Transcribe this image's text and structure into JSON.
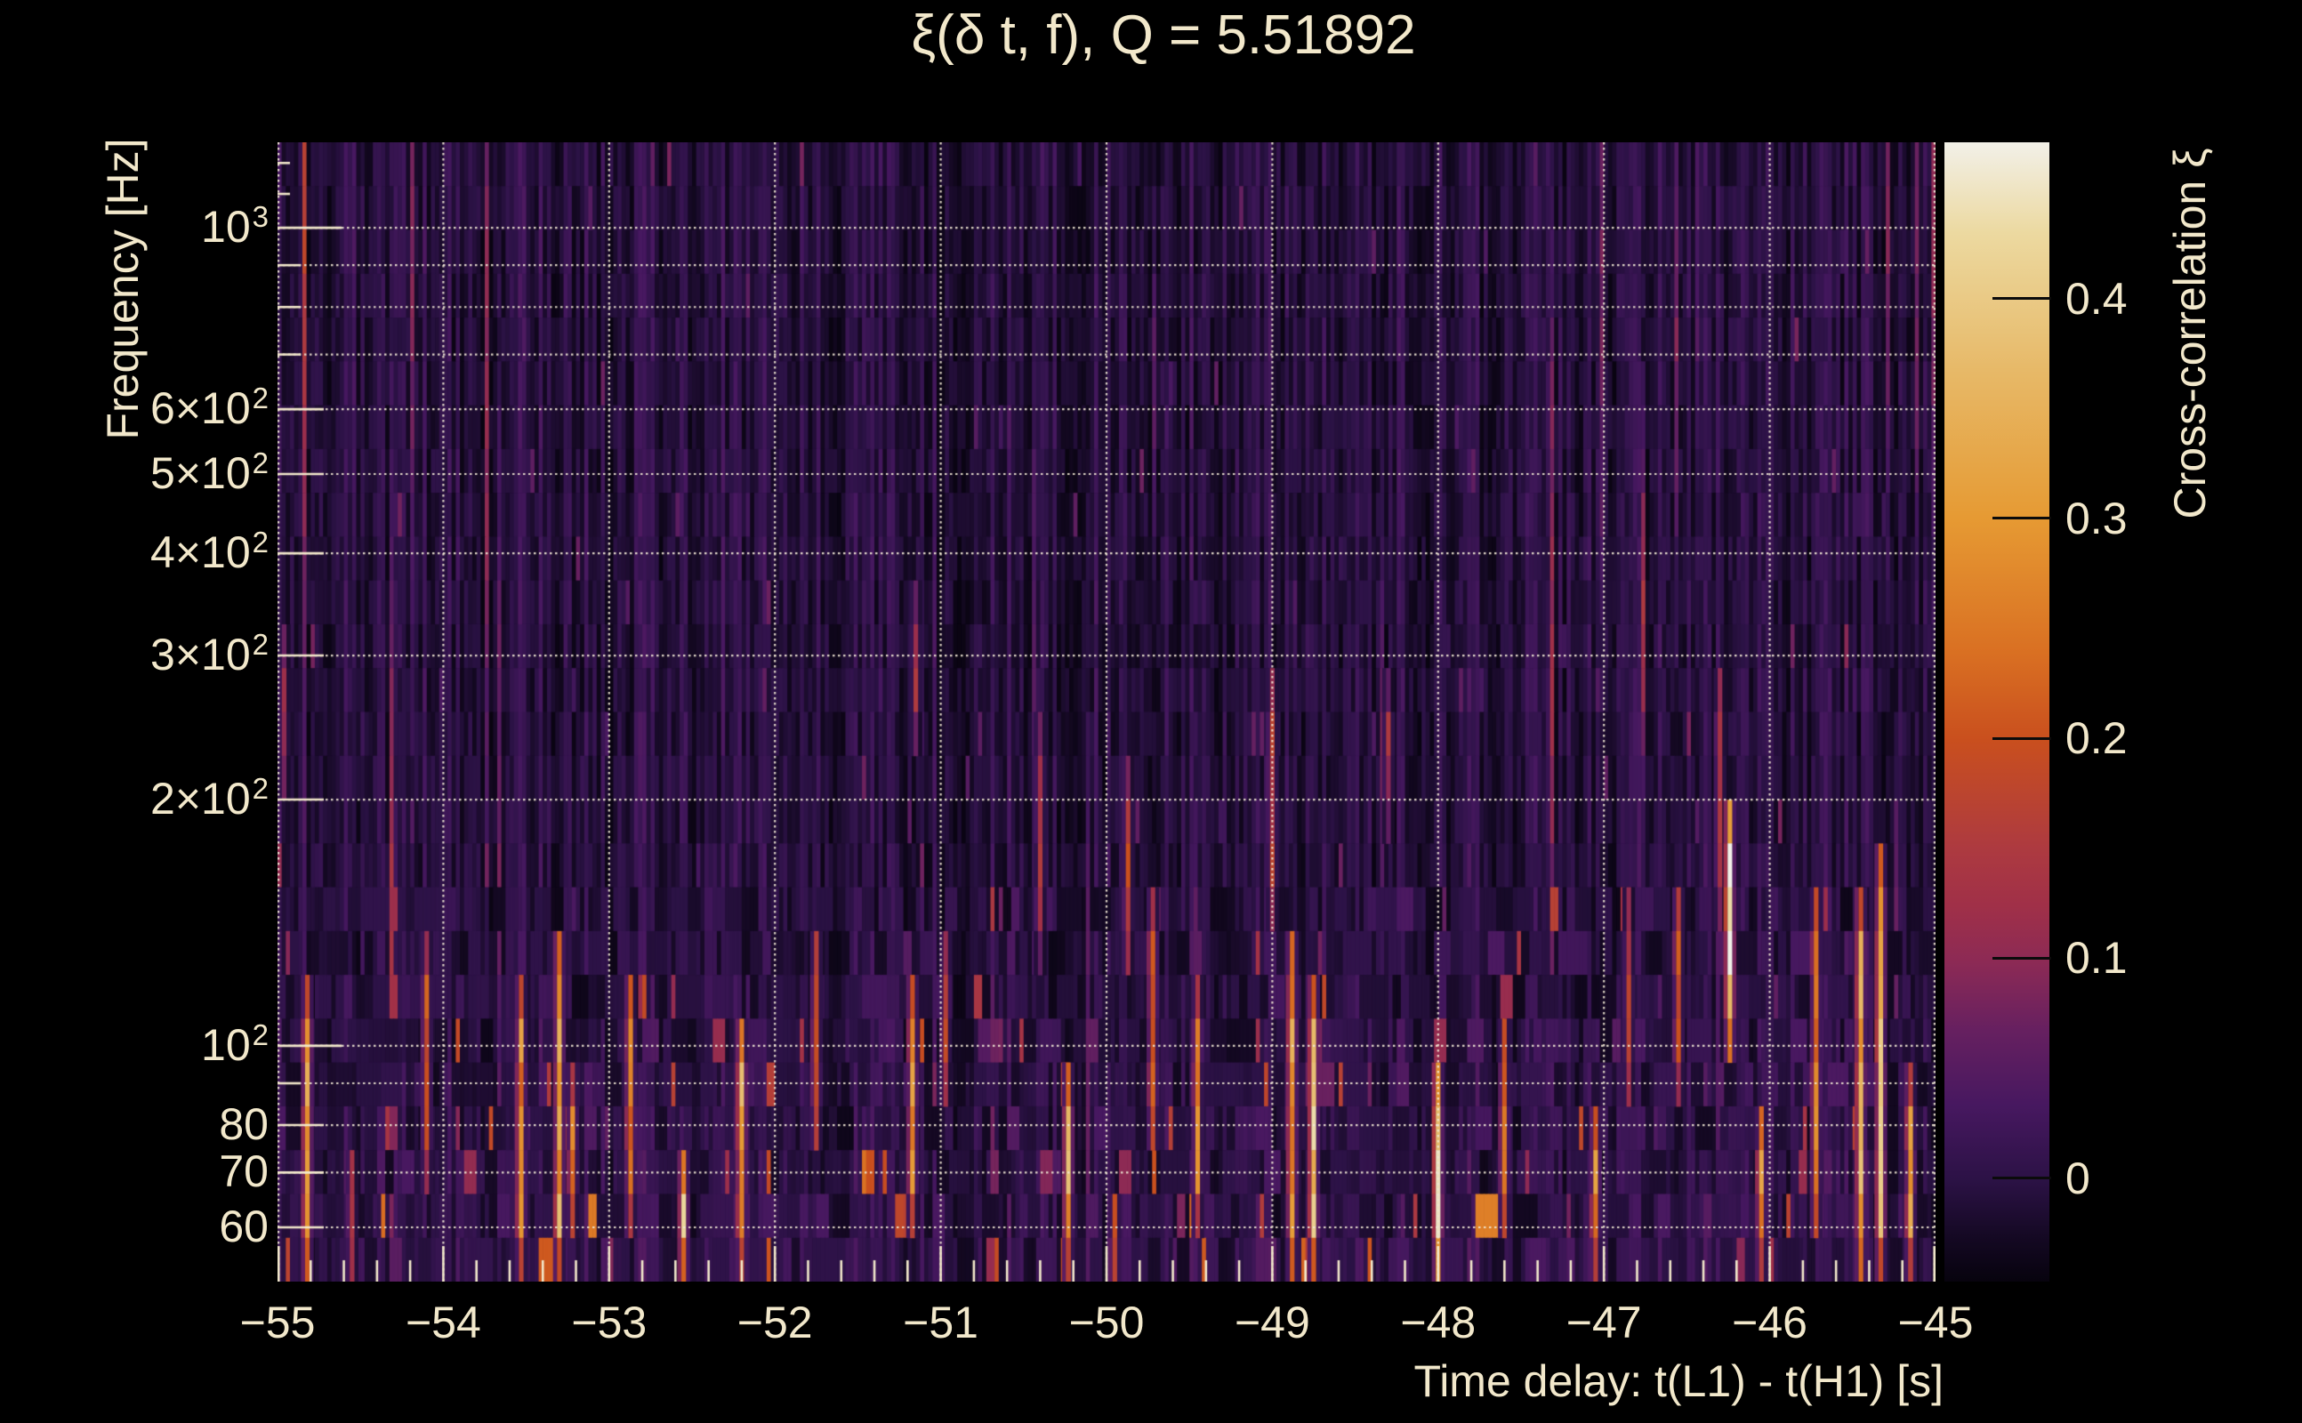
{
  "title": {
    "text": "ξ(δ t, f), Q = 5.51892"
  },
  "axes": {
    "x": {
      "title": "Time delay: t(L1) - t(H1) [s]",
      "range_s": [
        -55,
        -45
      ],
      "major_ticks": [
        {
          "value": -55,
          "label": "−55"
        },
        {
          "value": -54,
          "label": "−54"
        },
        {
          "value": -53,
          "label": "−53"
        },
        {
          "value": -52,
          "label": "−52"
        },
        {
          "value": -51,
          "label": "−51"
        },
        {
          "value": -50,
          "label": "−50"
        },
        {
          "value": -49,
          "label": "−49"
        },
        {
          "value": -48,
          "label": "−48"
        },
        {
          "value": -47,
          "label": "−47"
        },
        {
          "value": -46,
          "label": "−46"
        },
        {
          "value": -45,
          "label": "−45"
        }
      ],
      "minor_tick_step": 0.2
    },
    "y": {
      "title": "Frequency [Hz]",
      "scale": "log",
      "range_hz": [
        51.5,
        1272
      ],
      "tick_labels": [
        {
          "f": 1000,
          "base": "10",
          "sup": "3"
        },
        {
          "f": 600,
          "base": "6×10",
          "sup": "2"
        },
        {
          "f": 500,
          "base": "5×10",
          "sup": "2"
        },
        {
          "f": 400,
          "base": "4×10",
          "sup": "2"
        },
        {
          "f": 300,
          "base": "3×10",
          "sup": "2"
        },
        {
          "f": 200,
          "base": "2×10",
          "sup": "2"
        },
        {
          "f": 100,
          "base": "10",
          "sup": "2"
        },
        {
          "f": 80,
          "base": "80",
          "sup": ""
        },
        {
          "f": 70,
          "base": "70",
          "sup": ""
        },
        {
          "f": 60,
          "base": "60",
          "sup": ""
        }
      ],
      "gridline_freqs": [
        60,
        70,
        80,
        90,
        100,
        200,
        300,
        400,
        500,
        600,
        700,
        800,
        900,
        1000
      ],
      "decade_tick_freqs": [
        100,
        1000
      ],
      "unlabeled_tick_freqs": [
        90,
        700,
        800,
        900
      ],
      "tiny_tick_freqs": [
        1100,
        1200
      ]
    }
  },
  "colorbar": {
    "title": "Cross-correlation ξ",
    "range": [
      -0.047,
      0.471
    ],
    "ticks": [
      {
        "value": 0,
        "label": "0"
      },
      {
        "value": 0.1,
        "label": "0.1"
      },
      {
        "value": 0.2,
        "label": "0.2"
      },
      {
        "value": 0.3,
        "label": "0.3"
      },
      {
        "value": 0.4,
        "label": "0.4"
      }
    ]
  },
  "colors": {
    "background": "#000000",
    "text": "#f2e8cb",
    "grid": "#efe6d2",
    "tick": "#f2e8cb",
    "colorbar_tick_line": "#0b0b0b"
  },
  "chart_data": {
    "type": "heatmap",
    "title": "ξ(δ t, f), Q = 5.51892",
    "xlabel": "Time delay: t(L1) - t(H1) [s]",
    "ylabel": "Frequency [Hz]",
    "x_range_s": [
      -55,
      -45
    ],
    "y_range_hz": [
      51.5,
      1272
    ],
    "y_scale": "log",
    "z_range": [
      -0.047,
      0.471
    ],
    "grid": true,
    "legend_position": "right-colorbar",
    "palette": [
      {
        "u": 0.0,
        "color": "#07030e"
      },
      {
        "u": 0.04,
        "color": "#150924"
      },
      {
        "u": 0.09,
        "color": "#2c1246"
      },
      {
        "u": 0.155,
        "color": "#471860"
      },
      {
        "u": 0.22,
        "color": "#662060"
      },
      {
        "u": 0.28,
        "color": "#8c2a55"
      },
      {
        "u": 0.33,
        "color": "#a03048"
      },
      {
        "u": 0.38,
        "color": "#ad3a40"
      },
      {
        "u": 0.475,
        "color": "#c94f1e"
      },
      {
        "u": 0.55,
        "color": "#d96f22"
      },
      {
        "u": 0.67,
        "color": "#e69a33"
      },
      {
        "u": 0.8,
        "color": "#e7b968"
      },
      {
        "u": 0.92,
        "color": "#ecd9a0"
      },
      {
        "u": 1.0,
        "color": "#f2f0e8"
      }
    ],
    "background_noise": {
      "seed": 20250901,
      "cols": 400,
      "rows": 26,
      "base_xi": 0.0,
      "jitter_xi": 0.034,
      "low_freq_boost_start_rowfrac": 0.58,
      "note": "stochastic dark-purple vertical striations, amplitude increasing toward low frequency"
    },
    "hot_streaks": [
      {
        "t": -54.96,
        "f_lo": 210,
        "f_hi": 300,
        "xi": 0.13
      },
      {
        "t": -54.82,
        "f_lo": 52,
        "f_hi": 115,
        "xi": 0.31
      },
      {
        "t": -54.55,
        "f_lo": 52,
        "f_hi": 72,
        "xi": 0.18
      },
      {
        "t": -54.1,
        "f_lo": 70,
        "f_hi": 125,
        "xi": 0.22
      },
      {
        "t": -53.53,
        "f_lo": 58,
        "f_hi": 110,
        "xi": 0.28
      },
      {
        "t": -53.3,
        "f_lo": 52,
        "f_hi": 135,
        "xi": 0.33
      },
      {
        "t": -53.22,
        "f_lo": 60,
        "f_hi": 95,
        "xi": 0.25
      },
      {
        "t": -52.87,
        "f_lo": 65,
        "f_hi": 120,
        "xi": 0.27
      },
      {
        "t": -52.55,
        "f_lo": 52,
        "f_hi": 68,
        "xi": 0.38
      },
      {
        "t": -52.2,
        "f_lo": 52,
        "f_hi": 100,
        "xi": 0.33
      },
      {
        "t": -51.75,
        "f_lo": 80,
        "f_hi": 130,
        "xi": 0.22
      },
      {
        "t": -51.17,
        "f_lo": 60,
        "f_hi": 115,
        "xi": 0.28
      },
      {
        "t": -51.15,
        "f_lo": 240,
        "f_hi": 360,
        "xi": 0.13
      },
      {
        "t": -50.97,
        "f_lo": 85,
        "f_hi": 135,
        "xi": 0.2
      },
      {
        "t": -50.4,
        "f_lo": 130,
        "f_hi": 250,
        "xi": 0.14
      },
      {
        "t": -50.23,
        "f_lo": 52,
        "f_hi": 95,
        "xi": 0.33
      },
      {
        "t": -49.95,
        "f_lo": 52,
        "f_hi": 65,
        "xi": 0.28
      },
      {
        "t": -49.87,
        "f_lo": 130,
        "f_hi": 210,
        "xi": 0.17
      },
      {
        "t": -49.72,
        "f_lo": 75,
        "f_hi": 145,
        "xi": 0.24
      },
      {
        "t": -49.45,
        "f_lo": 60,
        "f_hi": 120,
        "xi": 0.26
      },
      {
        "t": -49.0,
        "f_lo": 150,
        "f_hi": 260,
        "xi": 0.16
      },
      {
        "t": -48.88,
        "f_lo": 52,
        "f_hi": 130,
        "xi": 0.3
      },
      {
        "t": -48.75,
        "f_lo": 55,
        "f_hi": 120,
        "xi": 0.38
      },
      {
        "t": -48.3,
        "f_lo": 180,
        "f_hi": 260,
        "xi": 0.13
      },
      {
        "t": -48.0,
        "f_lo": 52,
        "f_hi": 85,
        "xi": 0.42
      },
      {
        "t": -47.6,
        "f_lo": 60,
        "f_hi": 100,
        "xi": 0.25
      },
      {
        "t": -47.05,
        "f_lo": 52,
        "f_hi": 75,
        "xi": 0.28
      },
      {
        "t": -46.85,
        "f_lo": 95,
        "f_hi": 145,
        "xi": 0.16
      },
      {
        "t": -46.55,
        "f_lo": 90,
        "f_hi": 140,
        "xi": 0.22
      },
      {
        "t": -46.3,
        "f_lo": 150,
        "f_hi": 280,
        "xi": 0.15
      },
      {
        "t": -46.24,
        "f_lo": 100,
        "f_hi": 195,
        "xi": 0.45
      },
      {
        "t": -46.05,
        "f_lo": 52,
        "f_hi": 80,
        "xi": 0.3
      },
      {
        "t": -45.72,
        "f_lo": 60,
        "f_hi": 150,
        "xi": 0.26
      },
      {
        "t": -45.45,
        "f_lo": 52,
        "f_hi": 145,
        "xi": 0.36
      },
      {
        "t": -45.33,
        "f_lo": 52,
        "f_hi": 165,
        "xi": 0.36
      },
      {
        "t": -45.15,
        "f_lo": 52,
        "f_hi": 90,
        "xi": 0.3
      }
    ]
  }
}
